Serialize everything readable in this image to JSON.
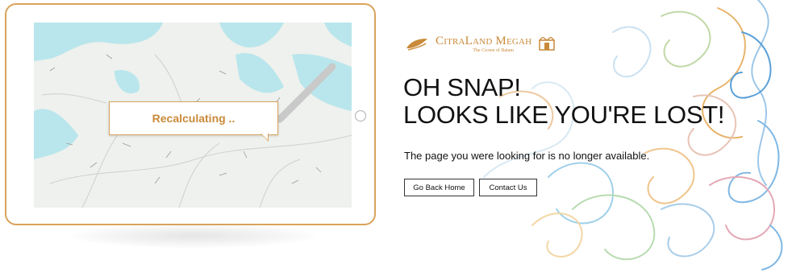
{
  "tablet": {
    "callout_text": "Recalculating .."
  },
  "brand": {
    "name": "CitraLand Megah",
    "tagline": "The Crown of Batam"
  },
  "error": {
    "headline_line1": "OH SNAP!",
    "headline_line2": "LOOKS LIKE YOU'RE LOST!",
    "message": "The page you were looking for is no longer available."
  },
  "actions": {
    "go_back_home_label": "Go Back Home",
    "contact_us_label": "Contact Us"
  },
  "colors": {
    "accent_gold": "#d9a35c",
    "text_dark": "#111111",
    "map_water": "#b9e6ec",
    "map_land": "#eef1ed"
  },
  "icons": {
    "tablet_home_button": "circle",
    "brand_logo": "leaf-mark",
    "brand_emblem": "crown-emblem"
  }
}
